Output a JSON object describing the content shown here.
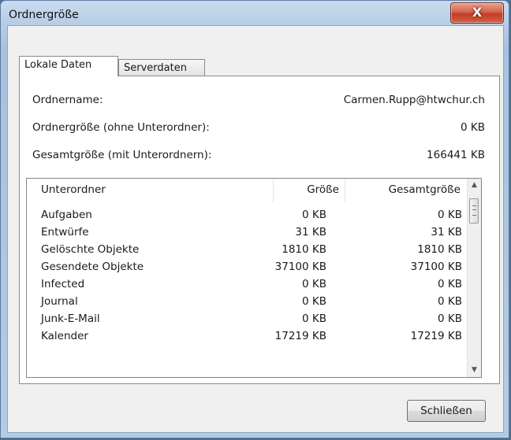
{
  "window": {
    "title": "Ordnergröße"
  },
  "tabs": [
    {
      "label": "Lokale Daten",
      "active": true
    },
    {
      "label": "Serverdaten",
      "active": false
    }
  ],
  "info": {
    "folder_name_label": "Ordnername:",
    "folder_name_value": "Carmen.Rupp@htwchur.ch",
    "folder_size_label": "Ordnergröße (ohne Unterordner):",
    "folder_size_value": "0 KB",
    "total_size_label": "Gesamtgröße (mit Unterordnern):",
    "total_size_value": "166441 KB"
  },
  "list": {
    "headers": [
      "Unterordner",
      "Größe",
      "Gesamtgröße"
    ],
    "rows": [
      [
        "Aufgaben",
        "0 KB",
        "0 KB"
      ],
      [
        "Entwürfe",
        "31 KB",
        "31 KB"
      ],
      [
        "Gelöschte Objekte",
        "1810 KB",
        "1810 KB"
      ],
      [
        "Gesendete Objekte",
        "37100 KB",
        "37100 KB"
      ],
      [
        "Infected",
        "0 KB",
        "0 KB"
      ],
      [
        "Journal",
        "0 KB",
        "0 KB"
      ],
      [
        "Junk-E-Mail",
        "0 KB",
        "0 KB"
      ],
      [
        "Kalender",
        "17219 KB",
        "17219 KB"
      ]
    ]
  },
  "buttons": {
    "close_label": "Schließen",
    "close_x": "X"
  },
  "icons": {
    "scroll_up": "up-arrow-icon",
    "scroll_down": "down-arrow-icon"
  },
  "colors": {
    "close_button": "#c94a31",
    "window_frame": "#b7cde6"
  }
}
